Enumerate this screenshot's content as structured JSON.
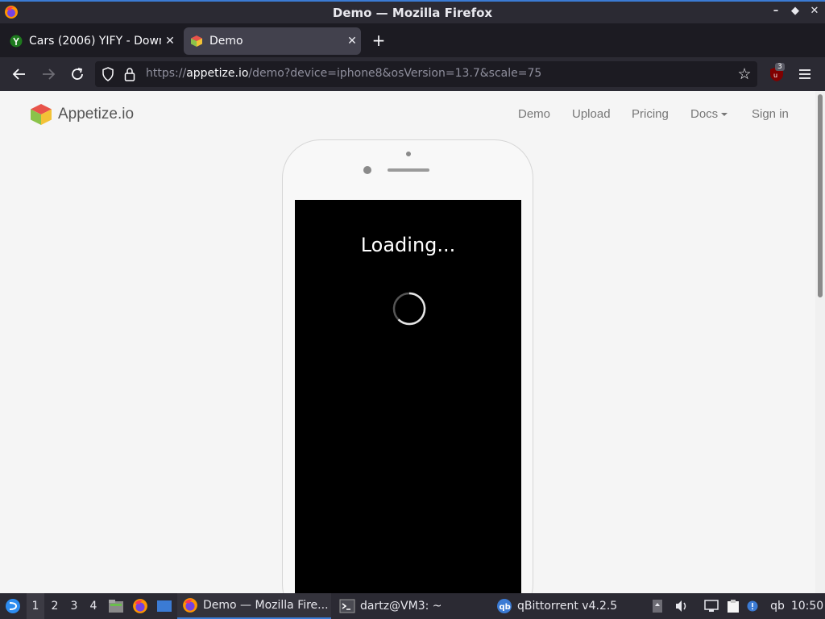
{
  "window": {
    "title": "Demo — Mozilla Firefox",
    "controls": [
      "–",
      "◆",
      "✕"
    ]
  },
  "tabs": [
    {
      "title": "Cars (2006) YIFY - Downl",
      "active": false
    },
    {
      "title": "Demo",
      "active": true
    }
  ],
  "urlbar": {
    "scheme": "https://",
    "host": "appetize.io",
    "path": "/demo?device=iphone8&osVersion=13.7&scale=75",
    "extension_badge": "3"
  },
  "page": {
    "logo_text": "Appetize.io",
    "nav": [
      "Demo",
      "Upload",
      "Pricing",
      "Docs",
      "Sign in"
    ],
    "device_screen": {
      "message": "Loading..."
    }
  },
  "taskbar": {
    "workspaces": [
      "1",
      "2",
      "3",
      "4"
    ],
    "active_workspace": "1",
    "tasks": [
      {
        "label": "Demo — Mozilla Fire...",
        "icon": "firefox-icon",
        "active": true
      },
      {
        "label": "dartz@VM3: ~",
        "icon": "terminal-icon",
        "active": false
      },
      {
        "label": "qBittorrent v4.2.5",
        "icon": "qbittorrent-icon",
        "active": false
      }
    ],
    "clock": "10:50",
    "tray_qb_label": "qb"
  },
  "colors": {
    "accent": "#3b7bd4",
    "browser_dark": "#2b2a33",
    "page_bg": "#f5f5f5",
    "device_screen": "#000000"
  }
}
